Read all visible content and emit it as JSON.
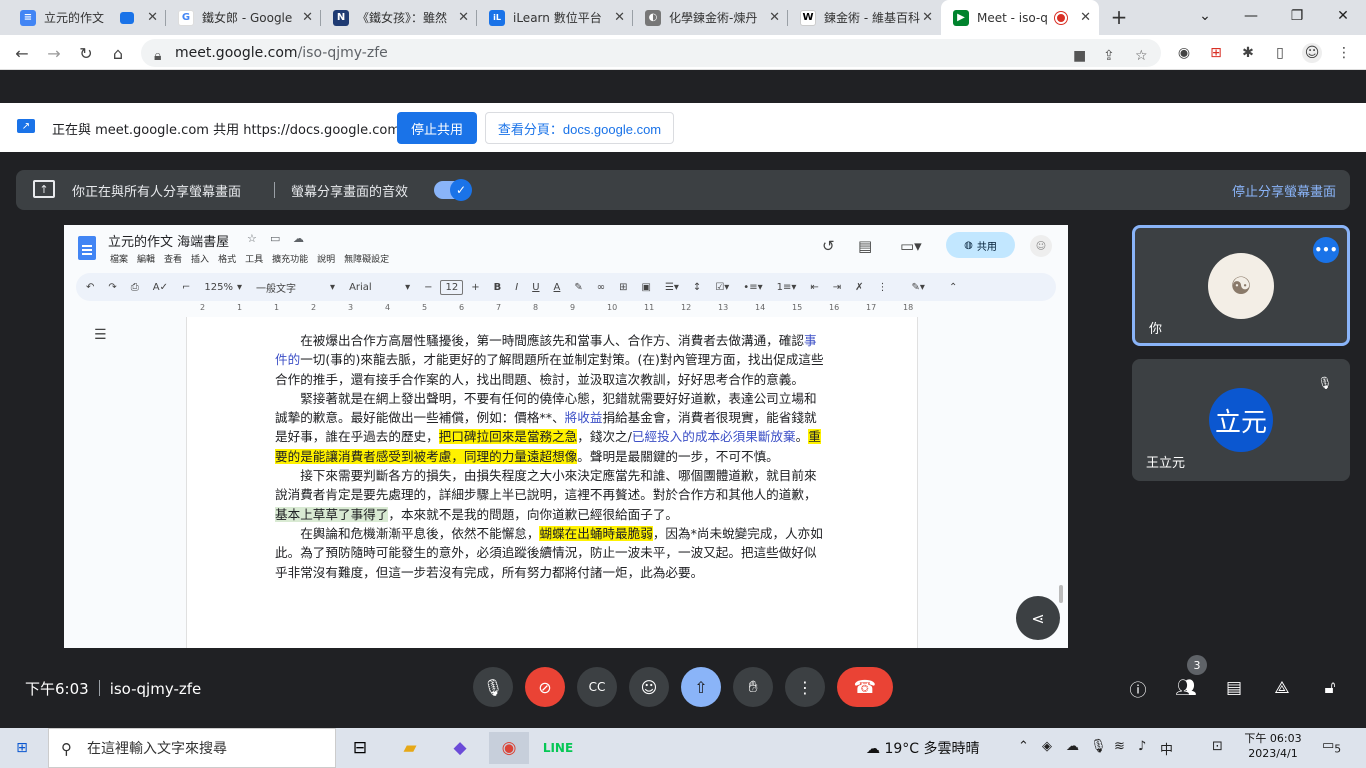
{
  "browser": {
    "tabs": [
      {
        "title": "立元的作文",
        "fav_color": "#4285f4",
        "fav": "≡"
      },
      {
        "title": "鐵女郎 - Google",
        "fav_color": "#fff",
        "fav": "G"
      },
      {
        "title": "《鐵女孩》：雖然",
        "fav_color": "#1f3b73",
        "fav": "N"
      },
      {
        "title": "iLearn 數位平台",
        "fav_color": "#1a73e8",
        "fav": "iL"
      },
      {
        "title": "化學鍊金術-煉丹",
        "fav_color": "#555",
        "fav": "◐"
      },
      {
        "title": "鍊金術 - 維基百科",
        "fav_color": "#fff",
        "fav": "W"
      },
      {
        "title": "Meet - iso-q",
        "fav_color": "#00832d",
        "fav": "▶"
      }
    ],
    "new_tab": "+",
    "url_host": "meet.google.com",
    "url_path": "/iso-qjmy-zfe"
  },
  "share_bar": {
    "message": "正在與 meet.google.com 共用 https://docs.google.com",
    "stop_label": "停止共用",
    "view_label": "查看分頁：docs.google.com"
  },
  "meet": {
    "notice_text": "你正在與所有人分享螢幕畫面",
    "audio_label": "螢幕分享畫面的音效",
    "stop_sharing": "停止分享螢幕畫面",
    "time": "下午6:03",
    "meeting_code": "iso-qjmy-zfe",
    "participant_count": "3",
    "tiles": [
      {
        "name": "你"
      },
      {
        "name": "王立元",
        "initials": "立元"
      }
    ]
  },
  "doc": {
    "title": "立元的作文 海端書屋",
    "menus": [
      "檔案",
      "編輯",
      "查看",
      "插入",
      "格式",
      "工具",
      "擴充功能",
      "說明",
      "無障礙設定"
    ],
    "share_label": "共用",
    "zoom": "125%",
    "style": "一般文字",
    "font": "Arial",
    "font_size": "12",
    "ruler": [
      "2",
      "1",
      "1",
      "2",
      "3",
      "4",
      "5",
      "6",
      "7",
      "8",
      "9",
      "10",
      "11",
      "12",
      "13",
      "14",
      "15",
      "16",
      "17",
      "18"
    ]
  },
  "taskbar": {
    "search_placeholder": "在這裡輸入文字來搜尋",
    "weather": "19°C 多雲時晴",
    "ime": "中",
    "time": "下午 06:03",
    "date": "2023/4/1",
    "notif_count": "5"
  }
}
